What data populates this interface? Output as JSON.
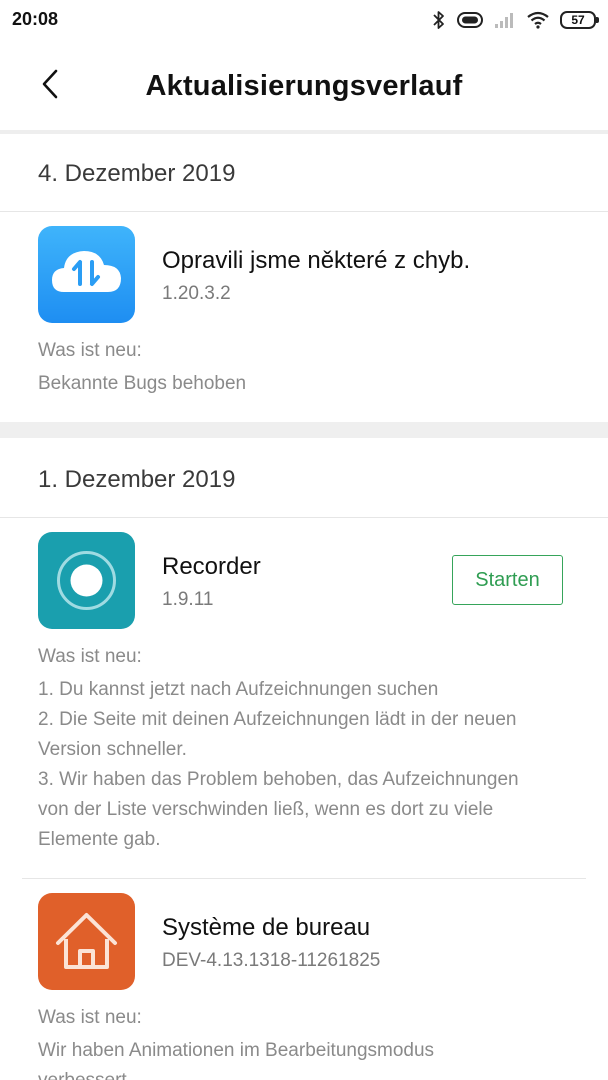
{
  "status_bar": {
    "time": "20:08",
    "battery": "57",
    "icons": [
      "bluetooth-icon",
      "vibrate-icon",
      "signal-icon",
      "wifi-icon",
      "battery-icon"
    ]
  },
  "header": {
    "title": "Aktualisierungsverlauf",
    "back_icon": "chevron-left-icon"
  },
  "sections": [
    {
      "date": "4. Dezember 2019",
      "apps": [
        {
          "name": "Opravili jsme některé z chyb.",
          "version": "1.20.3.2",
          "icon": "cloud-sync-icon",
          "icon_color": "#2a9df4",
          "whats_new_label": "Was ist neu:",
          "notes": [
            "Bekannte Bugs behoben"
          ]
        }
      ]
    },
    {
      "date": "1. Dezember 2019",
      "apps": [
        {
          "name": "Recorder",
          "version": "1.9.11",
          "icon": "record-icon",
          "icon_color": "#1a9fae",
          "action_label": "Starten",
          "whats_new_label": "Was ist neu:",
          "notes": [
            "1. Du kannst jetzt nach Aufzeichnungen suchen",
            "2. Die Seite mit deinen Aufzeichnungen lädt in der neuen",
            "Version schneller.",
            "3. Wir haben das Problem behoben, das Aufzeichnungen",
            "von der Liste verschwinden ließ, wenn es dort zu viele",
            "Elemente gab."
          ]
        },
        {
          "name": "Système de bureau",
          "version": "DEV-4.13.1318-11261825",
          "icon": "home-icon",
          "icon_color": "#e0602a",
          "whats_new_label": "Was ist neu:",
          "notes": [
            "Wir haben Animationen im Bearbeitungsmodus",
            "verbessert."
          ]
        }
      ]
    }
  ],
  "colors": {
    "accent_green": "#2f9d52",
    "secondary_text": "#8a8a8a",
    "section_gap": "#efefef"
  }
}
